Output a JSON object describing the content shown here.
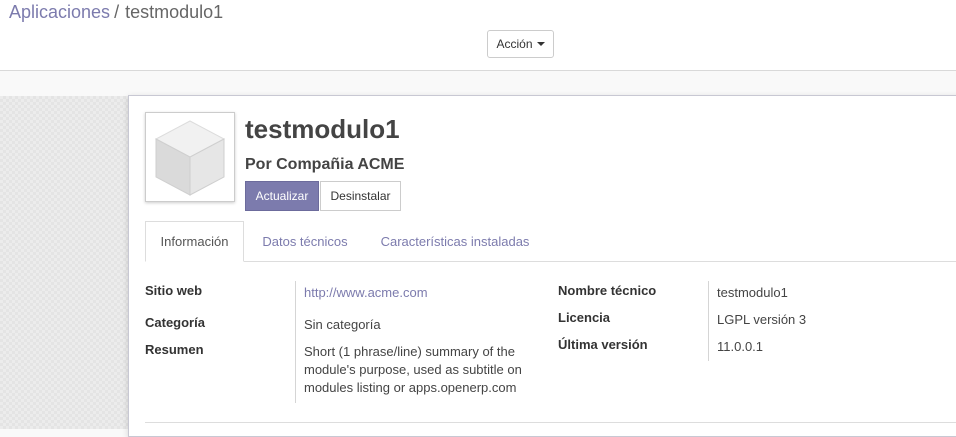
{
  "breadcrumb": {
    "parent": "Aplicaciones",
    "separator": "/",
    "current": "testmodulo1"
  },
  "toolbar": {
    "action_label": "Acción"
  },
  "module": {
    "name": "testmodulo1",
    "author": "Por Compañia ACME",
    "icon": "module-cube-icon",
    "update_label": "Actualizar",
    "uninstall_label": "Desinstalar"
  },
  "tabs": [
    {
      "label": "Información"
    },
    {
      "label": "Datos técnicos"
    },
    {
      "label": "Características instaladas"
    }
  ],
  "info": {
    "website_label": "Sitio web",
    "website_value": "http://www.acme.com",
    "category_label": "Categoría",
    "category_value": "Sin categoría",
    "summary_label": "Resumen",
    "summary_value": "Short (1 phrase/line) summary of the module's purpose, used as subtitle on modules listing or apps.openerp.com",
    "technical_name_label": "Nombre técnico",
    "technical_name_value": "testmodulo1",
    "license_label": "Licencia",
    "license_value": "LGPL versión 3",
    "latest_version_label": "Última versión",
    "latest_version_value": "11.0.0.1"
  },
  "colors": {
    "brand": "#7c7bad",
    "text": "#4c4c4c"
  }
}
